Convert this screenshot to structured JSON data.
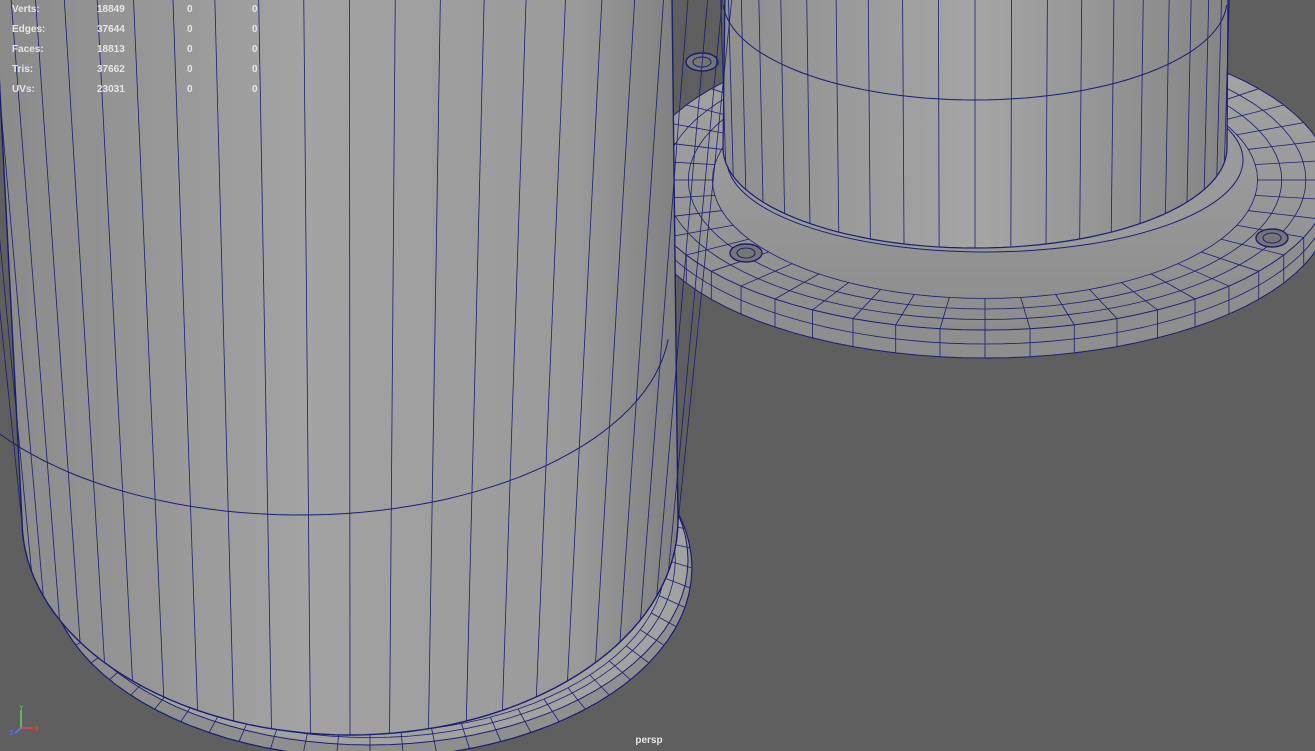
{
  "hud": {
    "rows": [
      {
        "label": "Verts:",
        "total": "18849",
        "selected": "0",
        "other": "0"
      },
      {
        "label": "Edges:",
        "total": "37644",
        "selected": "0",
        "other": "0"
      },
      {
        "label": "Faces:",
        "total": "18813",
        "selected": "0",
        "other": "0"
      },
      {
        "label": "Tris:",
        "total": "37662",
        "selected": "0",
        "other": "0"
      },
      {
        "label": "UVs:",
        "total": "23031",
        "selected": "0",
        "other": "0"
      }
    ]
  },
  "camera": {
    "name": "persp"
  },
  "axis": {
    "y": "Y",
    "x": "X",
    "z": "Z"
  },
  "colors": {
    "background": "#5f5f5f",
    "surface_light": "#a9a9a9",
    "surface_dark": "#7a7a7a",
    "wireframe": "#1a1e6e",
    "hud_text": "#e6e6e6",
    "axis_x": "#ff3c3c",
    "axis_y": "#58d858",
    "axis_z": "#5a78ff"
  }
}
